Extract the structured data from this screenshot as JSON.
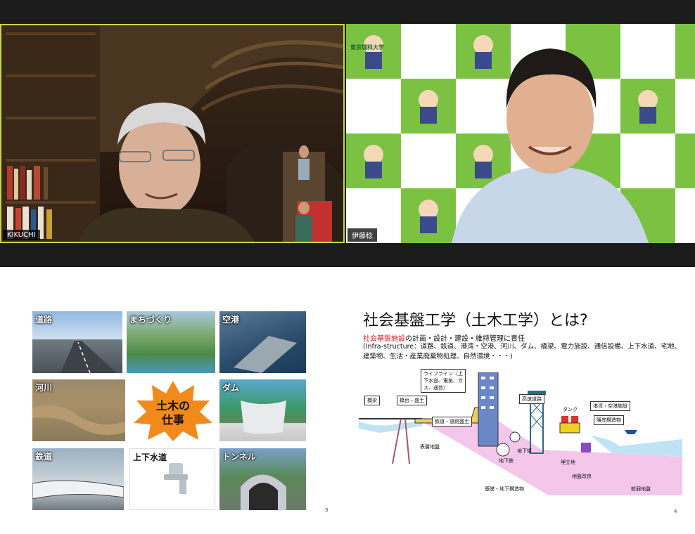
{
  "participants": [
    {
      "name": "KIKUCHI"
    },
    {
      "name": "伊藤稔"
    }
  ],
  "brand_text": "東京理科大学",
  "slide3": {
    "tiles": [
      {
        "label": "道路"
      },
      {
        "label": "まちづくり"
      },
      {
        "label": "空港"
      },
      {
        "label": "河川"
      },
      {
        "label": "ダム"
      },
      {
        "label": "鉄道"
      },
      {
        "label": "上下水道"
      },
      {
        "label": "トンネル"
      }
    ],
    "center_line1": "土木の",
    "center_line2": "仕事",
    "page_number": "3"
  },
  "slide4": {
    "title": "社会基盤工学（土木工学）とは?",
    "line1_red": "社会基盤施設",
    "line1_rest": "の計画・設計・建設・維持管理に責任",
    "line2": "(Infra-structure：道路、鉄道、港湾・空港、河川、ダム、橋梁、電力施設、通信設備、上下水道、宅地、建築物、生活・産業廃棄物処理、自然環境・・・)",
    "diagram_labels": {
      "bridge": "橋梁",
      "embank": "橋台・盛土",
      "lifeline": "ライフライン（上下水道、電気、ガス、通信）",
      "highway": "高速道路",
      "tank": "タンク",
      "port": "港湾・空港施設",
      "protect": "護岸構造物",
      "rail_embank": "鉄道・道路盛土",
      "surface": "表層地盤",
      "subway_st": "地下街",
      "subway": "地下鉄",
      "reclaim": "埋立地",
      "improve": "地盤改良",
      "foundation": "基礎・地下構造物",
      "soft": "軟弱地盤"
    },
    "page_number": "4"
  },
  "colors": {
    "tile_border": "#c8d64a",
    "brand_green": "#7cc242",
    "burst_orange": "#f28a1b",
    "ground_pink": "#f4c6ea",
    "water_blue": "#bfe3f5"
  }
}
